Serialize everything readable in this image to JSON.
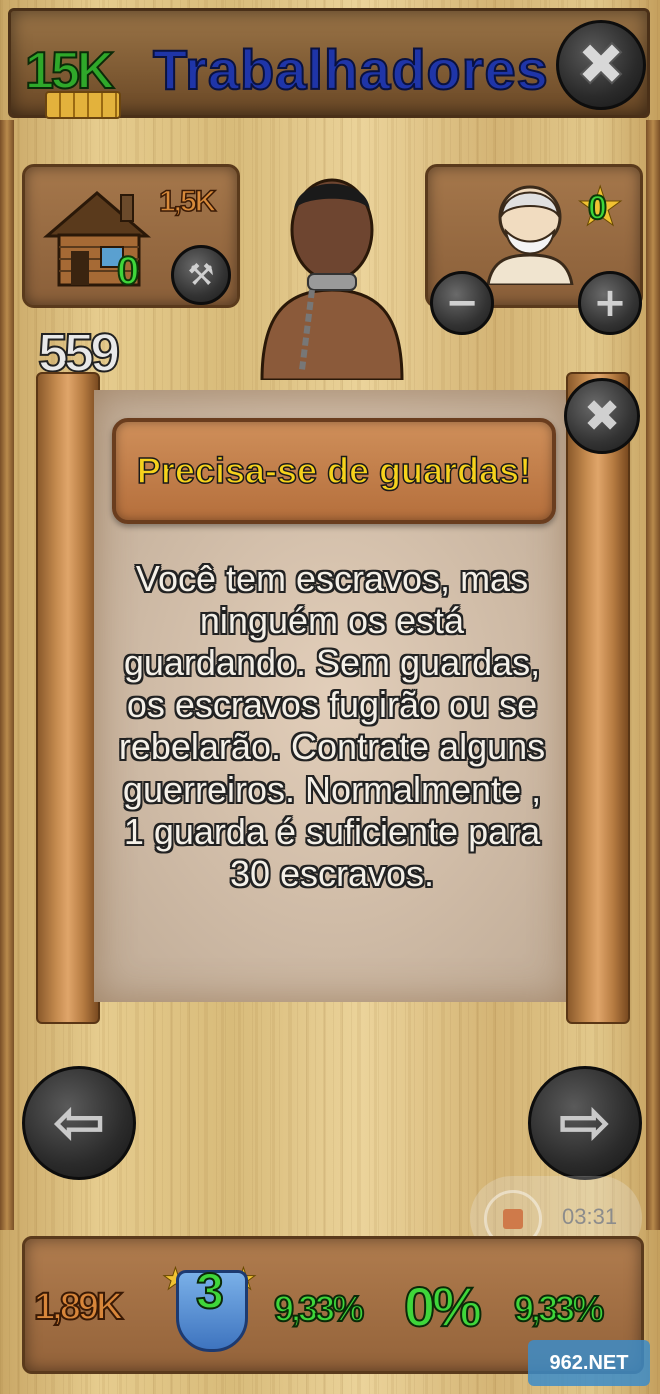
{
  "header": {
    "gold": "15K",
    "title": "Trabalhadores"
  },
  "top": {
    "house_cost": "1,5K",
    "house_count": "0",
    "elder_count": "0",
    "population": "559"
  },
  "dialog": {
    "title": "Precisa-se de guardas!",
    "body": "Você tem escravos, mas ninguém os está guardando. Sem guardas, os escravos fugirão ou se rebelarão. Contrate alguns guerreiros. Normalmente , 1 guarda é suficiente para 30 escravos."
  },
  "recorder": {
    "time": "03:31"
  },
  "footer": {
    "money": "1,89K",
    "level": "3",
    "stat_a": "9,33%",
    "stat_b": "0%",
    "stat_c": "9,33%"
  },
  "watermark": "962.NET"
}
